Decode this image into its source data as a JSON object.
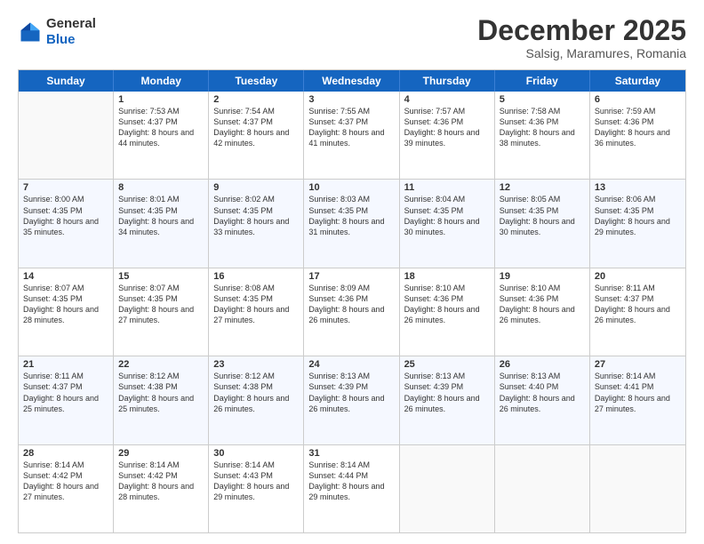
{
  "logo": {
    "general": "General",
    "blue": "Blue"
  },
  "title": "December 2025",
  "location": "Salsig, Maramures, Romania",
  "days": [
    "Sunday",
    "Monday",
    "Tuesday",
    "Wednesday",
    "Thursday",
    "Friday",
    "Saturday"
  ],
  "rows": [
    [
      {
        "day": "",
        "sunrise": "",
        "sunset": "",
        "daylight": "",
        "empty": true
      },
      {
        "day": "1",
        "sunrise": "Sunrise: 7:53 AM",
        "sunset": "Sunset: 4:37 PM",
        "daylight": "Daylight: 8 hours and 44 minutes."
      },
      {
        "day": "2",
        "sunrise": "Sunrise: 7:54 AM",
        "sunset": "Sunset: 4:37 PM",
        "daylight": "Daylight: 8 hours and 42 minutes."
      },
      {
        "day": "3",
        "sunrise": "Sunrise: 7:55 AM",
        "sunset": "Sunset: 4:37 PM",
        "daylight": "Daylight: 8 hours and 41 minutes."
      },
      {
        "day": "4",
        "sunrise": "Sunrise: 7:57 AM",
        "sunset": "Sunset: 4:36 PM",
        "daylight": "Daylight: 8 hours and 39 minutes."
      },
      {
        "day": "5",
        "sunrise": "Sunrise: 7:58 AM",
        "sunset": "Sunset: 4:36 PM",
        "daylight": "Daylight: 8 hours and 38 minutes."
      },
      {
        "day": "6",
        "sunrise": "Sunrise: 7:59 AM",
        "sunset": "Sunset: 4:36 PM",
        "daylight": "Daylight: 8 hours and 36 minutes."
      }
    ],
    [
      {
        "day": "7",
        "sunrise": "Sunrise: 8:00 AM",
        "sunset": "Sunset: 4:35 PM",
        "daylight": "Daylight: 8 hours and 35 minutes."
      },
      {
        "day": "8",
        "sunrise": "Sunrise: 8:01 AM",
        "sunset": "Sunset: 4:35 PM",
        "daylight": "Daylight: 8 hours and 34 minutes."
      },
      {
        "day": "9",
        "sunrise": "Sunrise: 8:02 AM",
        "sunset": "Sunset: 4:35 PM",
        "daylight": "Daylight: 8 hours and 33 minutes."
      },
      {
        "day": "10",
        "sunrise": "Sunrise: 8:03 AM",
        "sunset": "Sunset: 4:35 PM",
        "daylight": "Daylight: 8 hours and 31 minutes."
      },
      {
        "day": "11",
        "sunrise": "Sunrise: 8:04 AM",
        "sunset": "Sunset: 4:35 PM",
        "daylight": "Daylight: 8 hours and 30 minutes."
      },
      {
        "day": "12",
        "sunrise": "Sunrise: 8:05 AM",
        "sunset": "Sunset: 4:35 PM",
        "daylight": "Daylight: 8 hours and 30 minutes."
      },
      {
        "day": "13",
        "sunrise": "Sunrise: 8:06 AM",
        "sunset": "Sunset: 4:35 PM",
        "daylight": "Daylight: 8 hours and 29 minutes."
      }
    ],
    [
      {
        "day": "14",
        "sunrise": "Sunrise: 8:07 AM",
        "sunset": "Sunset: 4:35 PM",
        "daylight": "Daylight: 8 hours and 28 minutes."
      },
      {
        "day": "15",
        "sunrise": "Sunrise: 8:07 AM",
        "sunset": "Sunset: 4:35 PM",
        "daylight": "Daylight: 8 hours and 27 minutes."
      },
      {
        "day": "16",
        "sunrise": "Sunrise: 8:08 AM",
        "sunset": "Sunset: 4:35 PM",
        "daylight": "Daylight: 8 hours and 27 minutes."
      },
      {
        "day": "17",
        "sunrise": "Sunrise: 8:09 AM",
        "sunset": "Sunset: 4:36 PM",
        "daylight": "Daylight: 8 hours and 26 minutes."
      },
      {
        "day": "18",
        "sunrise": "Sunrise: 8:10 AM",
        "sunset": "Sunset: 4:36 PM",
        "daylight": "Daylight: 8 hours and 26 minutes."
      },
      {
        "day": "19",
        "sunrise": "Sunrise: 8:10 AM",
        "sunset": "Sunset: 4:36 PM",
        "daylight": "Daylight: 8 hours and 26 minutes."
      },
      {
        "day": "20",
        "sunrise": "Sunrise: 8:11 AM",
        "sunset": "Sunset: 4:37 PM",
        "daylight": "Daylight: 8 hours and 26 minutes."
      }
    ],
    [
      {
        "day": "21",
        "sunrise": "Sunrise: 8:11 AM",
        "sunset": "Sunset: 4:37 PM",
        "daylight": "Daylight: 8 hours and 25 minutes."
      },
      {
        "day": "22",
        "sunrise": "Sunrise: 8:12 AM",
        "sunset": "Sunset: 4:38 PM",
        "daylight": "Daylight: 8 hours and 25 minutes."
      },
      {
        "day": "23",
        "sunrise": "Sunrise: 8:12 AM",
        "sunset": "Sunset: 4:38 PM",
        "daylight": "Daylight: 8 hours and 26 minutes."
      },
      {
        "day": "24",
        "sunrise": "Sunrise: 8:13 AM",
        "sunset": "Sunset: 4:39 PM",
        "daylight": "Daylight: 8 hours and 26 minutes."
      },
      {
        "day": "25",
        "sunrise": "Sunrise: 8:13 AM",
        "sunset": "Sunset: 4:39 PM",
        "daylight": "Daylight: 8 hours and 26 minutes."
      },
      {
        "day": "26",
        "sunrise": "Sunrise: 8:13 AM",
        "sunset": "Sunset: 4:40 PM",
        "daylight": "Daylight: 8 hours and 26 minutes."
      },
      {
        "day": "27",
        "sunrise": "Sunrise: 8:14 AM",
        "sunset": "Sunset: 4:41 PM",
        "daylight": "Daylight: 8 hours and 27 minutes."
      }
    ],
    [
      {
        "day": "28",
        "sunrise": "Sunrise: 8:14 AM",
        "sunset": "Sunset: 4:42 PM",
        "daylight": "Daylight: 8 hours and 27 minutes."
      },
      {
        "day": "29",
        "sunrise": "Sunrise: 8:14 AM",
        "sunset": "Sunset: 4:42 PM",
        "daylight": "Daylight: 8 hours and 28 minutes."
      },
      {
        "day": "30",
        "sunrise": "Sunrise: 8:14 AM",
        "sunset": "Sunset: 4:43 PM",
        "daylight": "Daylight: 8 hours and 29 minutes."
      },
      {
        "day": "31",
        "sunrise": "Sunrise: 8:14 AM",
        "sunset": "Sunset: 4:44 PM",
        "daylight": "Daylight: 8 hours and 29 minutes."
      },
      {
        "day": "",
        "sunrise": "",
        "sunset": "",
        "daylight": "",
        "empty": true
      },
      {
        "day": "",
        "sunrise": "",
        "sunset": "",
        "daylight": "",
        "empty": true
      },
      {
        "day": "",
        "sunrise": "",
        "sunset": "",
        "daylight": "",
        "empty": true
      }
    ]
  ]
}
